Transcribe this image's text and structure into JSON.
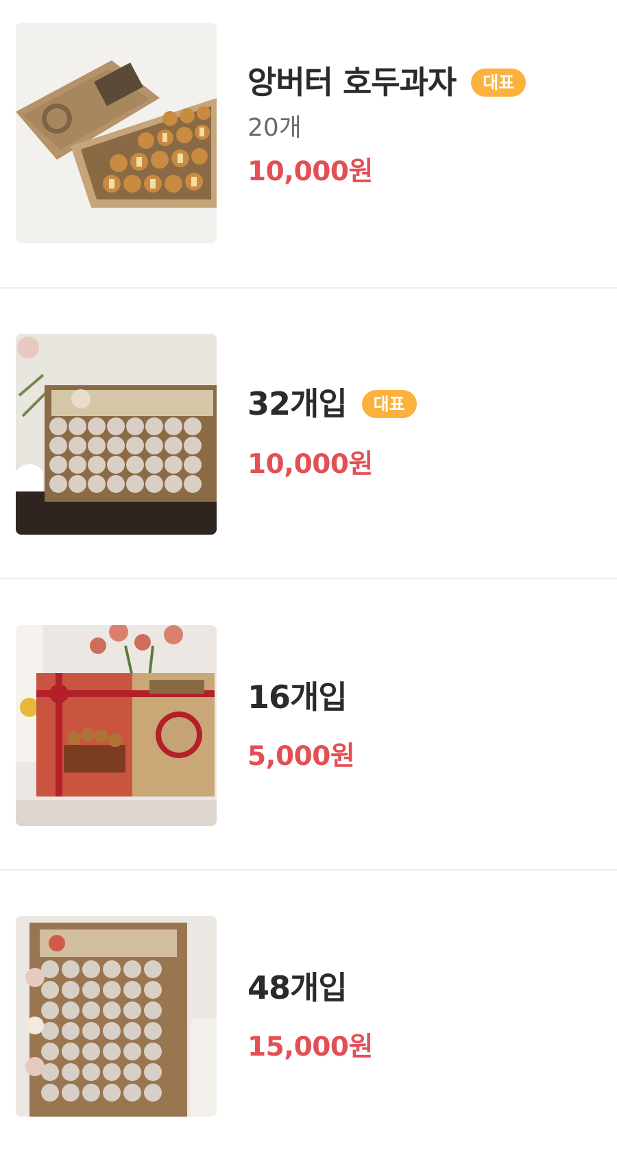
{
  "menu_items": [
    {
      "name": "앙버터 호두과자",
      "badge": "대표",
      "quantity": "20개",
      "price": "10,000원",
      "image_icon": "walnut-cake-box-photo"
    },
    {
      "name": "32개입",
      "badge": "대표",
      "price": "10,000원",
      "image_icon": "wrapped-walnut-cakes-photo"
    },
    {
      "name": "16개입",
      "price": "5,000원",
      "image_icon": "gift-box-photo"
    },
    {
      "name": "48개입",
      "price": "15,000원",
      "image_icon": "wrapped-walnut-cakes-photo"
    }
  ],
  "colors": {
    "price": "#e24f55",
    "badge": "#fbb13c",
    "name": "#2b2b2b",
    "quantity": "#6a6a6a",
    "divider": "#ececec"
  }
}
